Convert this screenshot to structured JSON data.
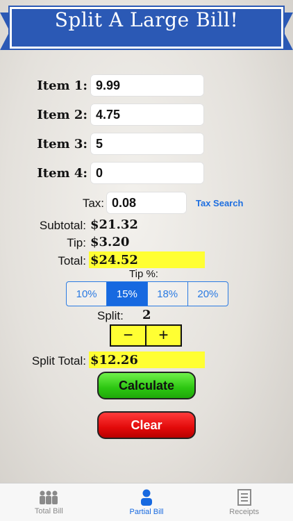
{
  "banner": {
    "title": "Split A Large Bill!"
  },
  "items": [
    {
      "label": "Item 1:",
      "value": "9.99"
    },
    {
      "label": "Item 2:",
      "value": "4.75"
    },
    {
      "label": "Item 3:",
      "value": "5"
    },
    {
      "label": "Item 4:",
      "value": "0"
    }
  ],
  "tax": {
    "label": "Tax:",
    "value": "0.08",
    "link": "Tax Search"
  },
  "summary": {
    "subtotal_label": "Subtotal:",
    "subtotal_value": "$21.32",
    "tip_label": "Tip:",
    "tip_value": "$3.20",
    "total_label": "Total:",
    "total_value": "$24.52"
  },
  "tip_percent": {
    "label": "Tip %:",
    "options": [
      "10%",
      "15%",
      "18%",
      "20%"
    ],
    "selected": "15%"
  },
  "split": {
    "label": "Split:",
    "value": "2",
    "minus": "−",
    "plus": "+"
  },
  "split_total": {
    "label": "Split Total:",
    "value": "$12.26"
  },
  "actions": {
    "calculate": "Calculate",
    "clear": "Clear"
  },
  "tabs": [
    {
      "label": "Total Bill",
      "icon": "group-icon",
      "active": false
    },
    {
      "label": "Partial Bill",
      "icon": "person-icon",
      "active": true
    },
    {
      "label": "Receipts",
      "icon": "receipt-icon",
      "active": false
    }
  ],
  "colors": {
    "banner": "#2b59b5",
    "highlight": "#ffff33",
    "accent": "#1769e0",
    "calculate": "#2cc611",
    "clear": "#e20a0a"
  }
}
